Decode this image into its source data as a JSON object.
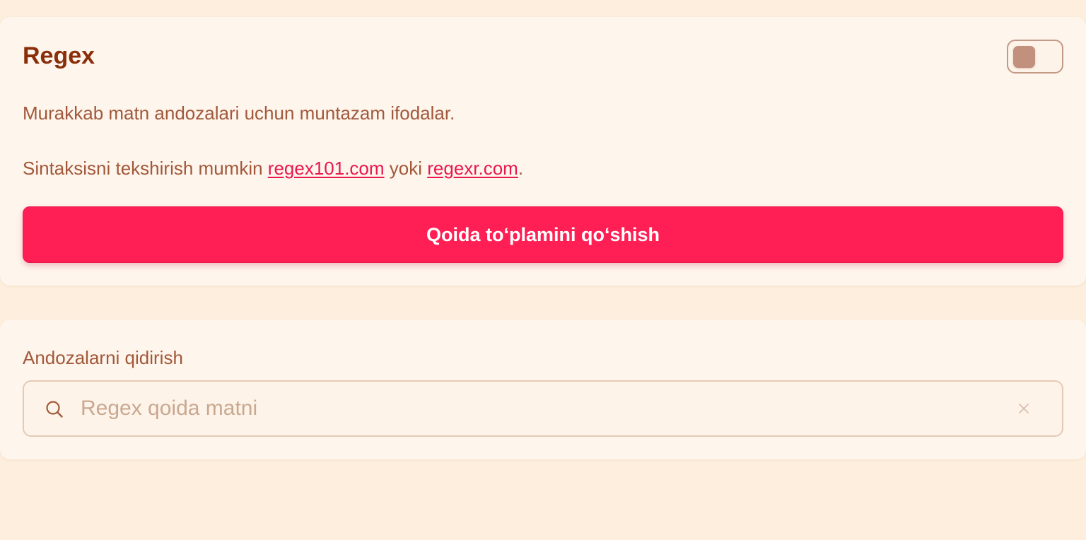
{
  "regex_card": {
    "title": "Regex",
    "toggle": {
      "enabled": false
    },
    "description": "Murakkab matn andozalari uchun muntazam ifodalar.",
    "syntax_prefix": "Sintaksisni tekshirish mumkin ",
    "link1": "regex101.com",
    "link_joiner": " yoki ",
    "link2": "regexr.com",
    "syntax_suffix": ".",
    "add_button_label": "Qoida toʻplamini qoʻshish"
  },
  "search_card": {
    "label": "Andozalarni qidirish",
    "input_value": "",
    "placeholder": "Regex qoida matni",
    "search_icon": "search-icon",
    "clear_icon": "close-icon"
  },
  "colors": {
    "page_background": "#fdeedd",
    "card_background": "#fef5ec",
    "title": "#8a2e0a",
    "text": "#a2583a",
    "accent": "#ff1f55",
    "link": "#e8184e",
    "toggle_knob": "#c2917d"
  }
}
